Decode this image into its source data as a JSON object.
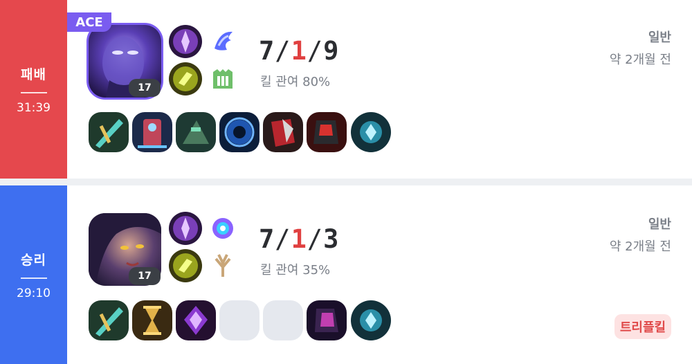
{
  "matches": [
    {
      "result": "패배",
      "duration": "31:39",
      "ace_badge": "ACE",
      "champion_level": "17",
      "kda": {
        "kills": "7",
        "deaths": "1",
        "assists": "9"
      },
      "kill_participation": "킬 관여 80%",
      "mode": "일반",
      "time_ago": "약 2개월 전",
      "spells": [
        "flash-spell-icon",
        "ghost-spell-icon"
      ],
      "runes": [
        "keystone-rune-icon",
        "resolve-rune-icon"
      ],
      "items": [
        "item-1",
        "item-2",
        "item-3",
        "item-4",
        "item-5",
        "item-6",
        "trinket"
      ],
      "color": "#e5484d"
    },
    {
      "result": "승리",
      "duration": "29:10",
      "champion_level": "17",
      "kda": {
        "kills": "7",
        "deaths": "1",
        "assists": "3"
      },
      "kill_participation": "킬 관여 35%",
      "mode": "일반",
      "time_ago": "약 2개월 전",
      "badge": "트리플킬",
      "spells": [
        "flash-spell-icon",
        "ghost-spell-icon"
      ],
      "runes": [
        "keystone-rune-icon",
        "inspiration-rune-icon"
      ],
      "items": [
        "item-1",
        "item-2",
        "item-3",
        "empty",
        "empty",
        "item-6",
        "trinket"
      ],
      "color": "#3e6ff0"
    }
  ],
  "separator": "/"
}
